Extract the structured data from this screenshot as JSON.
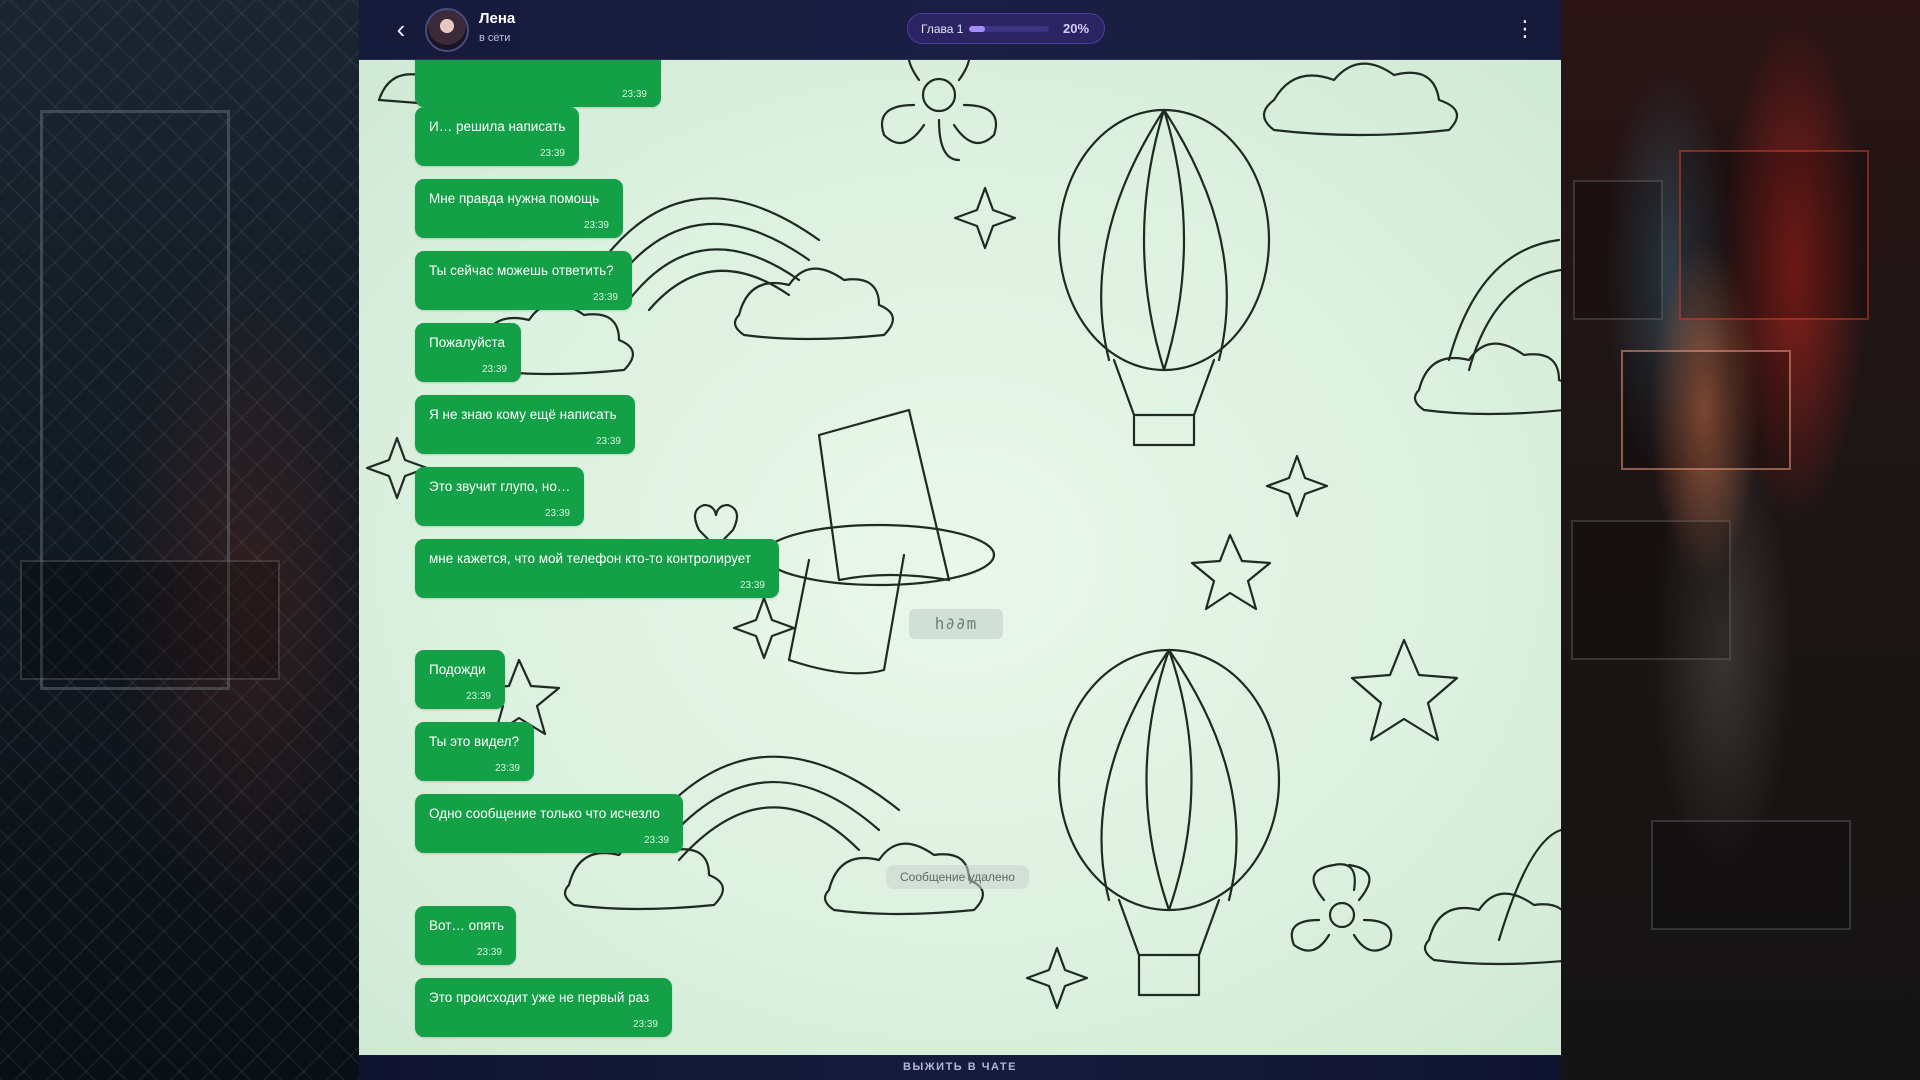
{
  "header": {
    "back_icon": "chevron-left-icon",
    "contact_name": "Лена",
    "contact_status": "в сети",
    "chapter_label": "Глава 1",
    "progress_text": "20%",
    "progress_fraction": 0.2,
    "menu_icon": "vertical-dots-icon"
  },
  "messages": [
    {
      "text": "",
      "time": "23:39"
    },
    {
      "text": "И… решила написать",
      "time": "23:39"
    },
    {
      "text": "Мне правда нужна помощь",
      "time": "23:39"
    },
    {
      "text": "Ты сейчас можешь ответить?",
      "time": "23:39"
    },
    {
      "text": "Пожалуйста",
      "time": "23:39"
    },
    {
      "text": "Я не знаю кому ещё написать",
      "time": "23:39"
    },
    {
      "text": "Это звучит глупо, но…",
      "time": "23:39"
    },
    {
      "text": "мне кажется, что мой телефон кто-то контролирует",
      "time": "23:39"
    },
    {
      "text": "Подожди",
      "time": "23:39"
    },
    {
      "text": "Ты это видел?",
      "time": "23:39"
    },
    {
      "text": "Одно сообщение только что исчезло",
      "time": "23:39"
    },
    {
      "text": "Вот… опять",
      "time": "23:39"
    },
    {
      "text": "Это происходит уже не первый раз",
      "time": "23:39"
    }
  ],
  "system": {
    "deleted_note": "Сообщение удалено",
    "glitch_text": "h∂∂m"
  },
  "footer": {
    "label": "ВЫЖИТЬ В ЧАТЕ"
  },
  "colors": {
    "bubble": "#14a047",
    "header_bg": "#1b1f44",
    "progress_pill": "#2a2463",
    "progress_fill": "#a88bff",
    "chat_bg": "#dcf1df"
  }
}
